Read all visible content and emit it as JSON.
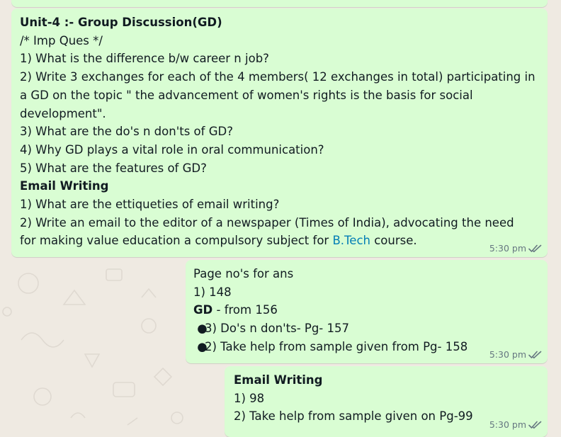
{
  "messages": [
    {
      "lines": {
        "title": "Unit-4 :- Group Discussion(GD)",
        "subtitle": "/* Imp Ques */",
        "q1": "1) What is the difference b/w career n job?",
        "q2a": "2) Write 3 exchanges for each of the 4 members( 12 exchanges in total) participating in",
        "q2b": "a GD on the topic \" the advancement of women's rights is the basis for social",
        "q2c": "development\".",
        "q3": "3) What are the do's n don'ts of GD?",
        "q4": "4) Why GD plays a vital role in oral communication?",
        "q5": "5) What are the features of GD?",
        "email_heading": "Email Writing",
        "e1": "1) What are the ettiqueties of email writing?",
        "e2a": "2) Write an email to the editor of a newspaper (Times of India), advocating the need",
        "e2b_pre": "for making value education a compulsory subject for ",
        "e2b_link": "B.Tech",
        "e2b_post": " course."
      },
      "time": "5:30 pm"
    },
    {
      "lines": {
        "l1": "Page no's for ans",
        "l2": "1) 148",
        "gd_bold": "GD",
        "gd_rest": " - from 156",
        "bullet1": "3) Do's n don'ts- Pg- 157",
        "bullet2": "2) Take help from sample given from Pg- 158"
      },
      "time": "5:30 pm"
    },
    {
      "lines": {
        "heading": "Email Writing",
        "l1": "1) 98",
        "l2": "2) Take help from sample given on Pg-99"
      },
      "time": "5:30 pm"
    }
  ],
  "colors": {
    "outgoing_bubble": "#d9fdd3",
    "chat_background": "#efeae2",
    "read_ticks": "#667781",
    "link": "#027eb5"
  },
  "icons": {
    "read_status": "double-check-icon",
    "bullet": "bullet-dot"
  }
}
